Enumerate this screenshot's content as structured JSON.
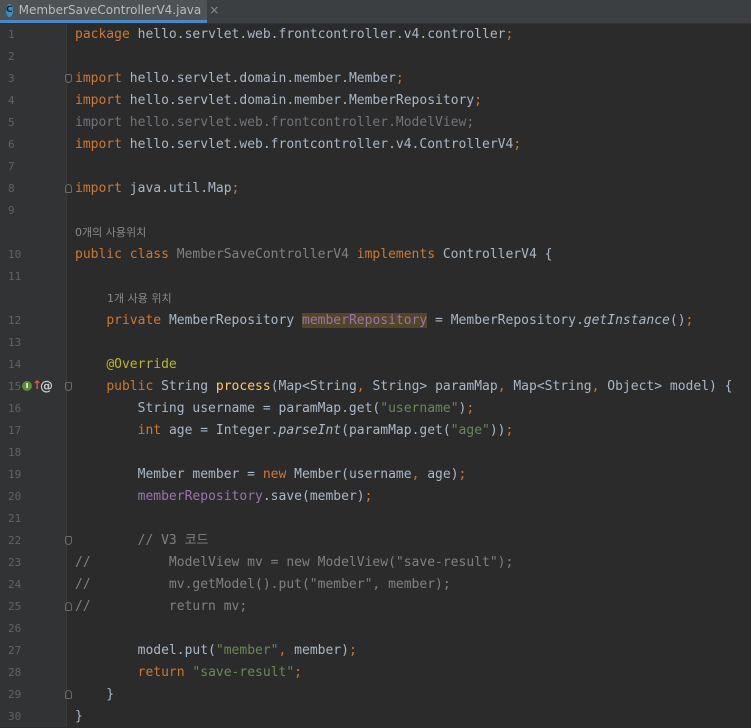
{
  "tab": {
    "icon_letter": "C",
    "filename": "MemberSaveControllerV4.java",
    "close_glyph": "×"
  },
  "colors": {
    "background": "#2b2b2b",
    "keyword": "#cc7832",
    "string": "#6a8759",
    "annotation": "#bbb529",
    "field": "#9876aa",
    "method": "#ffc66d",
    "comment": "#808080"
  },
  "code_lines": [
    {
      "ln": "1",
      "tokens": [
        {
          "t": "package",
          "c": "kw"
        },
        {
          "t": " hello.servlet.web.frontcontroller.v4.controller"
        },
        {
          "t": ";",
          "c": "kw"
        }
      ]
    },
    {
      "ln": "2",
      "tokens": []
    },
    {
      "ln": "3",
      "fold": "down",
      "tokens": [
        {
          "t": "import",
          "c": "kw"
        },
        {
          "t": " hello.servlet.domain.member.Member"
        },
        {
          "t": ";",
          "c": "kw"
        }
      ]
    },
    {
      "ln": "4",
      "tokens": [
        {
          "t": "import",
          "c": "kw"
        },
        {
          "t": " hello.servlet.domain.member.MemberRepository"
        },
        {
          "t": ";",
          "c": "kw"
        }
      ]
    },
    {
      "ln": "5",
      "tokens": [
        {
          "t": "import hello.servlet.web.frontcontroller.ModelView;",
          "c": "dim"
        }
      ]
    },
    {
      "ln": "6",
      "tokens": [
        {
          "t": "import",
          "c": "kw"
        },
        {
          "t": " hello.servlet.web.frontcontroller.v4.ControllerV4"
        },
        {
          "t": ";",
          "c": "kw"
        }
      ]
    },
    {
      "ln": "7",
      "tokens": []
    },
    {
      "ln": "8",
      "fold": "up",
      "tokens": [
        {
          "t": "import",
          "c": "kw"
        },
        {
          "t": " java.util.Map"
        },
        {
          "t": ";",
          "c": "kw"
        }
      ]
    },
    {
      "ln": "9",
      "tokens": []
    },
    {
      "hint": "0개의 사용위치",
      "hint_indent": 0
    },
    {
      "ln": "10",
      "tokens": [
        {
          "t": "public class ",
          "c": "kw"
        },
        {
          "t": "MemberSaveControllerV4",
          "c": "gray"
        },
        {
          "t": " implements ",
          "c": "kw"
        },
        {
          "t": "ControllerV4 {"
        }
      ]
    },
    {
      "ln": "11",
      "tokens": []
    },
    {
      "hint": "1개 사용 위치",
      "hint_indent": 1
    },
    {
      "ln": "12",
      "tokens": [
        {
          "t": "    "
        },
        {
          "t": "private ",
          "c": "kw"
        },
        {
          "t": "MemberRepository "
        },
        {
          "t": "memberRepository",
          "c": "fld hl"
        },
        {
          "t": " = MemberRepository."
        },
        {
          "t": "getInstance",
          "c": "ital"
        },
        {
          "t": "()"
        },
        {
          "t": ";",
          "c": "kw"
        }
      ]
    },
    {
      "ln": "13",
      "tokens": []
    },
    {
      "ln": "14",
      "tokens": [
        {
          "t": "    "
        },
        {
          "t": "@Override",
          "c": "ann"
        }
      ]
    },
    {
      "ln": "15",
      "fold": "down",
      "gutter_icons": true,
      "tokens": [
        {
          "t": "    "
        },
        {
          "t": "public ",
          "c": "kw"
        },
        {
          "t": "String "
        },
        {
          "t": "process",
          "c": "mth"
        },
        {
          "t": "(Map<String"
        },
        {
          "t": ", ",
          "c": "kw"
        },
        {
          "t": "String> paramMap"
        },
        {
          "t": ", ",
          "c": "kw"
        },
        {
          "t": "Map<String"
        },
        {
          "t": ", ",
          "c": "kw"
        },
        {
          "t": "Object> model) {"
        }
      ]
    },
    {
      "ln": "16",
      "tokens": [
        {
          "t": "        String username = paramMap.get("
        },
        {
          "t": "\"username\"",
          "c": "str"
        },
        {
          "t": ")"
        },
        {
          "t": ";",
          "c": "kw"
        }
      ]
    },
    {
      "ln": "17",
      "tokens": [
        {
          "t": "        "
        },
        {
          "t": "int ",
          "c": "kw"
        },
        {
          "t": "age = Integer."
        },
        {
          "t": "parseInt",
          "c": "ital"
        },
        {
          "t": "(paramMap.get("
        },
        {
          "t": "\"age\"",
          "c": "str"
        },
        {
          "t": "))"
        },
        {
          "t": ";",
          "c": "kw"
        }
      ]
    },
    {
      "ln": "18",
      "tokens": []
    },
    {
      "ln": "19",
      "tokens": [
        {
          "t": "        Member member = "
        },
        {
          "t": "new ",
          "c": "kw"
        },
        {
          "t": "Member(username"
        },
        {
          "t": ", ",
          "c": "kw"
        },
        {
          "t": "age)"
        },
        {
          "t": ";",
          "c": "kw"
        }
      ]
    },
    {
      "ln": "20",
      "tokens": [
        {
          "t": "        "
        },
        {
          "t": "memberRepository",
          "c": "fld"
        },
        {
          "t": ".save(member)"
        },
        {
          "t": ";",
          "c": "kw"
        }
      ]
    },
    {
      "ln": "21",
      "tokens": []
    },
    {
      "ln": "22",
      "fold": "down",
      "tokens": [
        {
          "t": "        // V3 코드",
          "c": "cmt"
        }
      ]
    },
    {
      "ln": "23",
      "tokens": [
        {
          "t": "//          ModelView mv = new ModelView(\"save-result\");",
          "c": "cmt"
        }
      ]
    },
    {
      "ln": "24",
      "tokens": [
        {
          "t": "//          mv.getModel().put(\"member\", member);",
          "c": "cmt"
        }
      ]
    },
    {
      "ln": "25",
      "fold": "up",
      "tokens": [
        {
          "t": "//          return mv;",
          "c": "cmt"
        }
      ]
    },
    {
      "ln": "26",
      "tokens": []
    },
    {
      "ln": "27",
      "tokens": [
        {
          "t": "        model.put("
        },
        {
          "t": "\"member\"",
          "c": "str"
        },
        {
          "t": ", ",
          "c": "kw"
        },
        {
          "t": "member)"
        },
        {
          "t": ";",
          "c": "kw"
        }
      ]
    },
    {
      "ln": "28",
      "tokens": [
        {
          "t": "        "
        },
        {
          "t": "return ",
          "c": "kw"
        },
        {
          "t": "\"save-result\"",
          "c": "str"
        },
        {
          "t": ";",
          "c": "kw"
        }
      ]
    },
    {
      "ln": "29",
      "fold": "up",
      "tokens": [
        {
          "t": "    }"
        }
      ]
    },
    {
      "ln": "30",
      "tokens": [
        {
          "t": "}"
        }
      ]
    }
  ]
}
